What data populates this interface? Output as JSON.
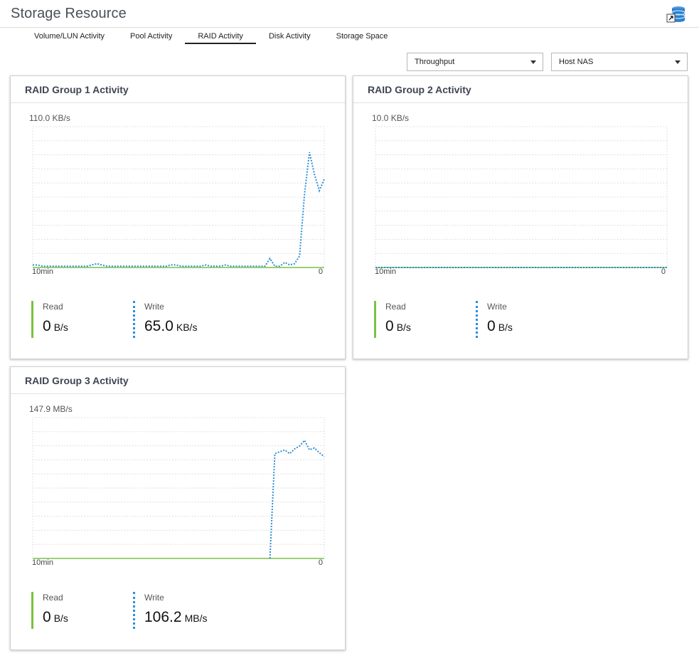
{
  "header": {
    "title": "Storage Resource",
    "icon": "storage-app-icon"
  },
  "tabs": [
    {
      "label": "Volume/LUN Activity",
      "active": false
    },
    {
      "label": "Pool Activity",
      "active": false
    },
    {
      "label": "RAID Activity",
      "active": true
    },
    {
      "label": "Disk Activity",
      "active": false
    },
    {
      "label": "Storage Space",
      "active": false
    }
  ],
  "filters": {
    "metric": "Throughput",
    "source": "Host NAS"
  },
  "colors": {
    "read": "#7ac143",
    "write": "#2b8fd8",
    "grid": "#e0e0e0"
  },
  "cards": [
    {
      "title": "RAID Group 1 Activity",
      "max_label": "110.0 KB/s",
      "x_start": "10min",
      "x_end": "0",
      "read": {
        "label": "Read",
        "value": "0",
        "unit": "B/s"
      },
      "write": {
        "label": "Write",
        "value": "65.0",
        "unit": "KB/s"
      }
    },
    {
      "title": "RAID Group 2 Activity",
      "max_label": "10.0 KB/s",
      "x_start": "10min",
      "x_end": "0",
      "read": {
        "label": "Read",
        "value": "0",
        "unit": "B/s"
      },
      "write": {
        "label": "Write",
        "value": "0",
        "unit": "B/s"
      }
    },
    {
      "title": "RAID Group 3 Activity",
      "max_label": "147.9 MB/s",
      "x_start": "10min",
      "x_end": "0",
      "read": {
        "label": "Read",
        "value": "0",
        "unit": "B/s"
      },
      "write": {
        "label": "Write",
        "value": "106.2",
        "unit": "MB/s"
      }
    }
  ],
  "chart_data": [
    {
      "type": "line",
      "title": "RAID Group 1 Activity",
      "unit": "KB/s",
      "ylim": [
        0,
        110
      ],
      "grid": true,
      "series": [
        {
          "name": "Read",
          "values": [
            0,
            0,
            0,
            0,
            0,
            0,
            0,
            0,
            0,
            0,
            0,
            0,
            0,
            0,
            0,
            0,
            0,
            0,
            0,
            0,
            0,
            0,
            0,
            0,
            0,
            0,
            0,
            0,
            0,
            0,
            0,
            0,
            0,
            0,
            0,
            0,
            0,
            0,
            0,
            0,
            0,
            0,
            0,
            0,
            0,
            0,
            0,
            0,
            0,
            0,
            0,
            0,
            0,
            0,
            0,
            0,
            0,
            0,
            0,
            0
          ]
        },
        {
          "name": "Write",
          "values": [
            2,
            2,
            1,
            1,
            1,
            1,
            1,
            1,
            1,
            1,
            1,
            1,
            2,
            3,
            2,
            1,
            1,
            1,
            1,
            1,
            1,
            1,
            1,
            1,
            1,
            1,
            1,
            1,
            2,
            2,
            1,
            1,
            1,
            1,
            1,
            2,
            1,
            1,
            1,
            2,
            1,
            1,
            1,
            1,
            1,
            1,
            1,
            1,
            7,
            1,
            1,
            4,
            2,
            3,
            9,
            57,
            90,
            73,
            60,
            69
          ]
        }
      ]
    },
    {
      "type": "line",
      "title": "RAID Group 2 Activity",
      "unit": "KB/s",
      "ylim": [
        0,
        10
      ],
      "grid": true,
      "series": [
        {
          "name": "Read",
          "values": [
            0,
            0,
            0,
            0,
            0,
            0,
            0,
            0,
            0,
            0,
            0,
            0,
            0,
            0,
            0,
            0,
            0,
            0,
            0,
            0,
            0,
            0,
            0,
            0,
            0,
            0,
            0,
            0,
            0,
            0,
            0,
            0,
            0,
            0,
            0,
            0,
            0,
            0,
            0,
            0,
            0,
            0,
            0,
            0,
            0,
            0,
            0,
            0,
            0,
            0,
            0,
            0,
            0,
            0,
            0,
            0,
            0,
            0,
            0,
            0
          ]
        },
        {
          "name": "Write",
          "values": [
            0,
            0,
            0,
            0,
            0,
            0,
            0,
            0,
            0,
            0,
            0,
            0,
            0,
            0,
            0,
            0,
            0,
            0,
            0,
            0,
            0,
            0,
            0,
            0,
            0,
            0,
            0,
            0,
            0,
            0,
            0,
            0,
            0,
            0,
            0,
            0,
            0,
            0,
            0,
            0,
            0,
            0,
            0,
            0,
            0,
            0,
            0,
            0,
            0,
            0,
            0,
            0,
            0,
            0,
            0,
            0,
            0,
            0,
            0,
            0
          ]
        }
      ]
    },
    {
      "type": "line",
      "title": "RAID Group 3 Activity",
      "unit": "MB/s",
      "ylim": [
        0,
        147.9
      ],
      "grid": true,
      "series": [
        {
          "name": "Read",
          "values": [
            0,
            0,
            0,
            0,
            0,
            0,
            0,
            0,
            0,
            0,
            0,
            0,
            0,
            0,
            0,
            0,
            0,
            0,
            0,
            0,
            0,
            0,
            0,
            0,
            0,
            0,
            0,
            0,
            0,
            0,
            0,
            0,
            0,
            0,
            0,
            0,
            0,
            0,
            0,
            0,
            0,
            0,
            0,
            0,
            0,
            0,
            0,
            0,
            0,
            0,
            0,
            0,
            0,
            0,
            0,
            0,
            0,
            0,
            0,
            0
          ]
        },
        {
          "name": "Write",
          "values": [
            null,
            null,
            null,
            null,
            null,
            null,
            null,
            null,
            null,
            null,
            null,
            null,
            null,
            null,
            null,
            null,
            null,
            null,
            null,
            null,
            null,
            null,
            null,
            null,
            null,
            null,
            null,
            null,
            null,
            null,
            null,
            null,
            null,
            null,
            null,
            null,
            null,
            null,
            null,
            null,
            null,
            null,
            null,
            null,
            null,
            null,
            null,
            null,
            0,
            110,
            112,
            114,
            110,
            115,
            118,
            124,
            114,
            116,
            111,
            107
          ]
        }
      ]
    }
  ]
}
